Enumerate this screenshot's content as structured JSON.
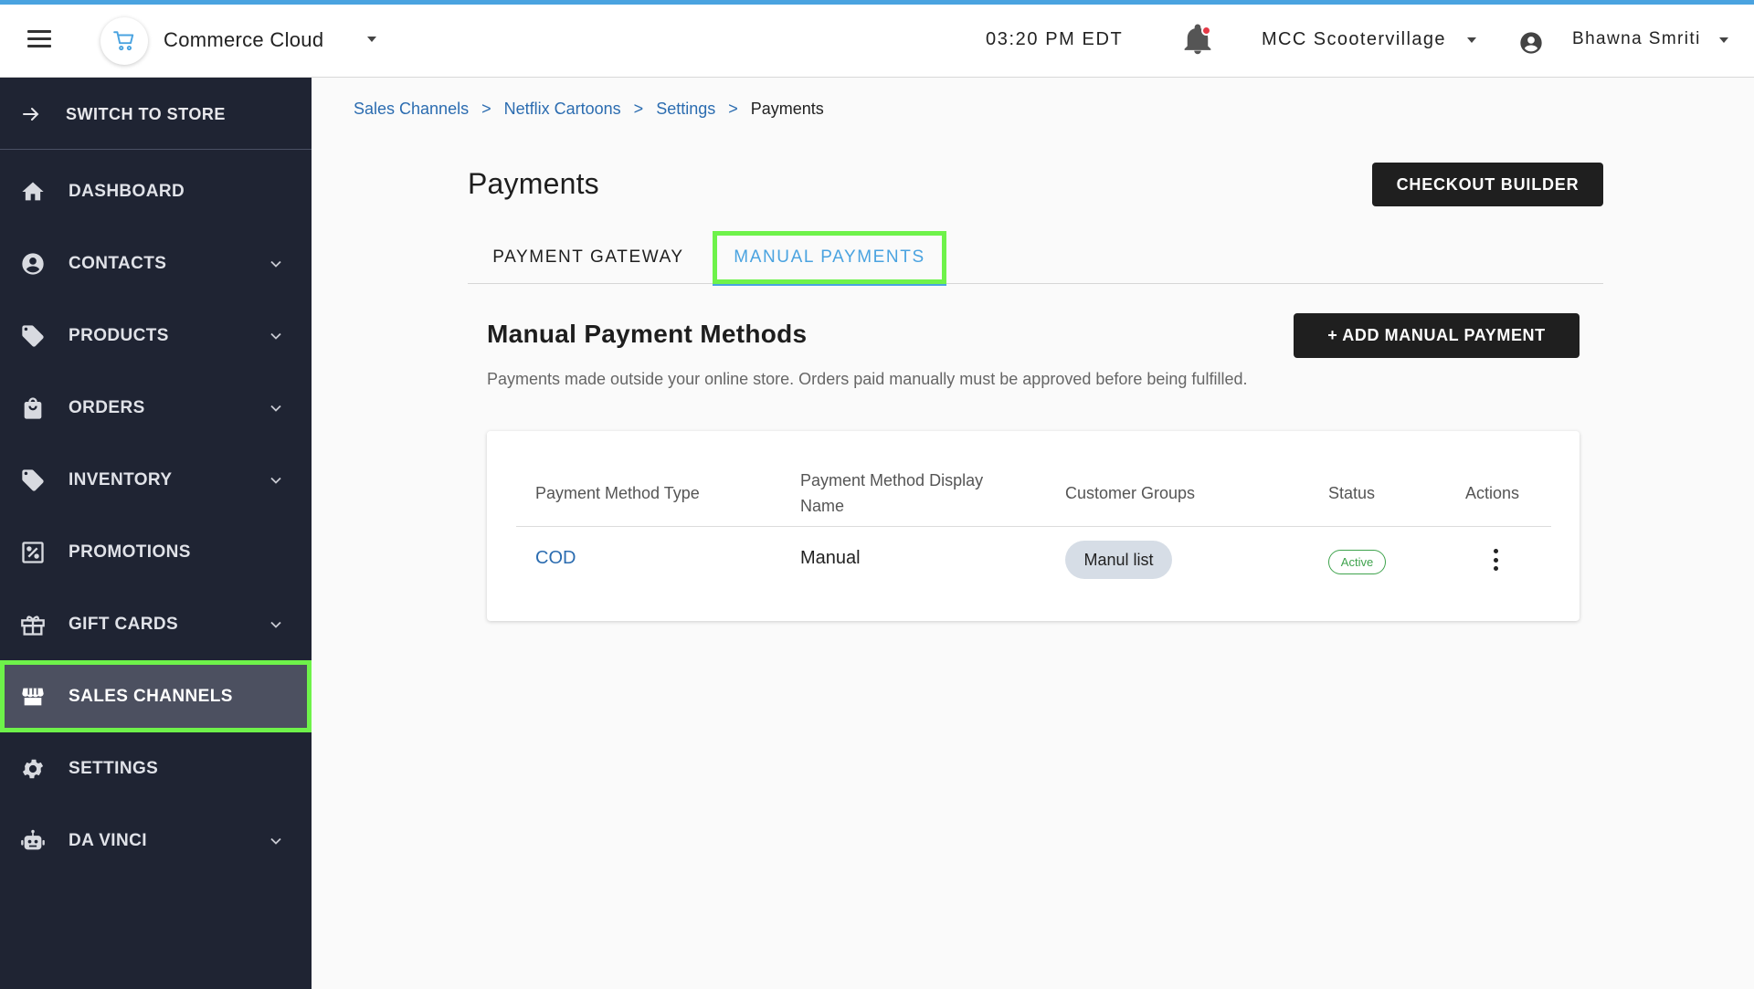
{
  "header": {
    "app_name": "Commerce Cloud",
    "time": "03:20 PM EDT",
    "store": "MCC Scootervillage",
    "user": "Bhawna Smriti"
  },
  "sidebar": {
    "switch_label": "SWITCH TO STORE",
    "items": [
      {
        "label": "DASHBOARD",
        "icon": "home-icon",
        "has_chevron": false
      },
      {
        "label": "CONTACTS",
        "icon": "account-circle-icon",
        "has_chevron": true
      },
      {
        "label": "PRODUCTS",
        "icon": "tag-icon",
        "has_chevron": true
      },
      {
        "label": "ORDERS",
        "icon": "shopping-bag-icon",
        "has_chevron": true
      },
      {
        "label": "INVENTORY",
        "icon": "tag-icon",
        "has_chevron": true
      },
      {
        "label": "PROMOTIONS",
        "icon": "percent-icon",
        "has_chevron": false
      },
      {
        "label": "GIFT CARDS",
        "icon": "gift-icon",
        "has_chevron": true
      },
      {
        "label": "SALES CHANNELS",
        "icon": "storefront-icon",
        "has_chevron": false,
        "active": true
      },
      {
        "label": "SETTINGS",
        "icon": "gear-icon",
        "has_chevron": false
      },
      {
        "label": "DA VINCI",
        "icon": "robot-icon",
        "has_chevron": true
      }
    ]
  },
  "breadcrumb": {
    "items": [
      "Sales Channels",
      "Netflix Cartoons",
      "Settings"
    ],
    "separator": ">",
    "current": "Payments"
  },
  "page": {
    "title": "Payments",
    "checkout_button": "CHECKOUT BUILDER",
    "tabs": [
      "PAYMENT GATEWAY",
      "MANUAL PAYMENTS"
    ],
    "active_tab": "MANUAL PAYMENTS"
  },
  "section": {
    "title": "Manual Payment Methods",
    "add_button": "+ ADD MANUAL PAYMENT",
    "description": "Payments made outside your online store. Orders paid manually must be approved before being fulfilled."
  },
  "table": {
    "headers": [
      "Payment Method Type",
      "Payment Method Display Name",
      "Customer Groups",
      "Status",
      "Actions"
    ],
    "rows": [
      {
        "type": "COD",
        "display_name": "Manual",
        "customer_group": "Manul list",
        "status": "Active"
      }
    ]
  },
  "colors": {
    "accent": "#4aa3e0",
    "link": "#2b6cb0",
    "highlight": "#6ef24a",
    "sidebar_bg": "#1f2433",
    "status_active": "#3fa34d"
  }
}
